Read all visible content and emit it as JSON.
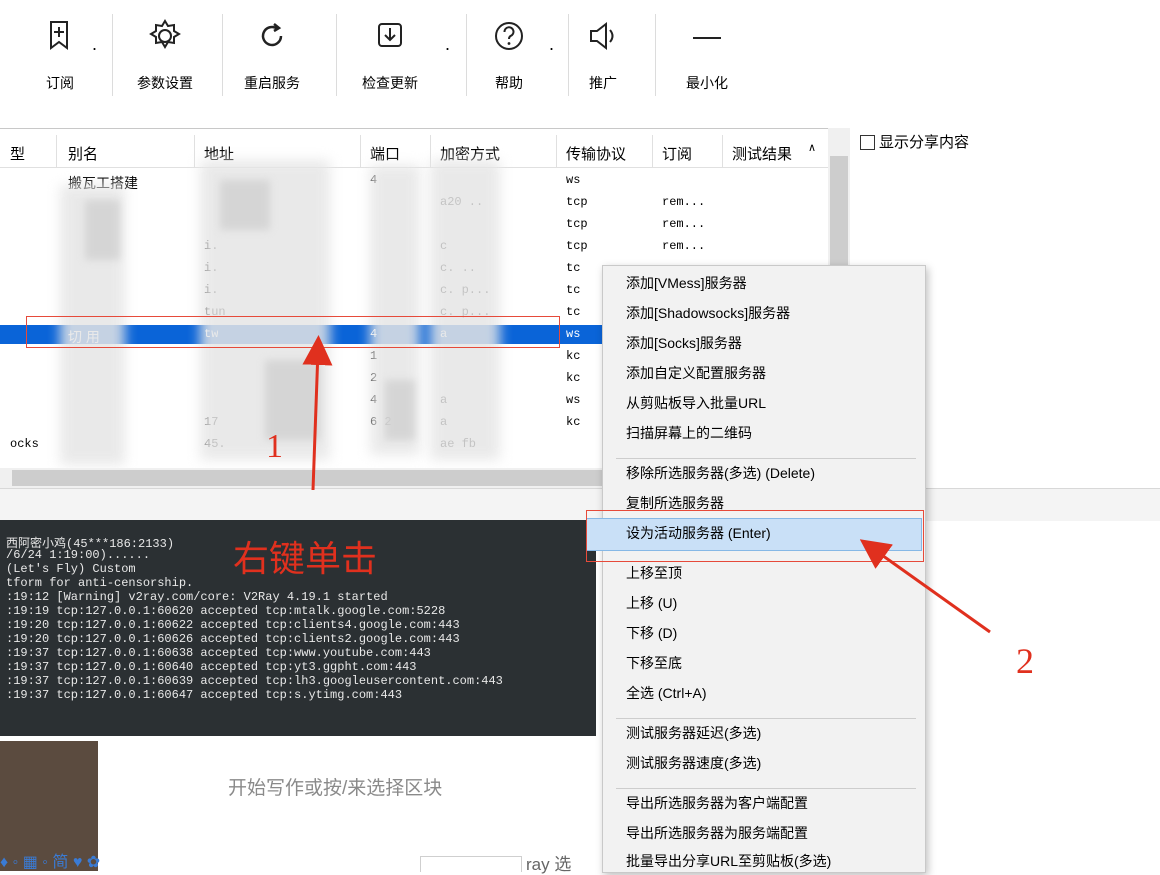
{
  "toolbar": {
    "buttons": [
      {
        "label": "订阅",
        "icon": "subscribe-icon",
        "has_dropdown": true
      },
      {
        "label": "参数设置",
        "icon": "gear-icon",
        "has_dropdown": false
      },
      {
        "label": "重启服务",
        "icon": "restart-icon",
        "has_dropdown": false
      },
      {
        "label": "检查更新",
        "icon": "download-icon",
        "has_dropdown": true
      },
      {
        "label": "帮助",
        "icon": "help-icon",
        "has_dropdown": true
      },
      {
        "label": "推广",
        "icon": "speaker-icon",
        "has_dropdown": false
      },
      {
        "label": "最小化",
        "icon": "minimize-icon",
        "has_dropdown": false
      }
    ]
  },
  "server_list": {
    "columns": [
      "型",
      "别名",
      "地址",
      "端口",
      "加密方式",
      "传输协议",
      "订阅",
      "测试结果"
    ],
    "rows": [
      {
        "alias": "搬瓦工搭建",
        "address": "",
        "port": "4",
        "security": "",
        "network": "ws",
        "subid": ""
      },
      {
        "alias": "",
        "address": "",
        "port": "",
        "security": "a20 ..",
        "network": "tcp",
        "subid": "rem..."
      },
      {
        "alias": "",
        "address": "",
        "port": "",
        "security": "",
        "network": "tcp",
        "subid": "rem..."
      },
      {
        "alias": "",
        "address": "i.",
        "port": "",
        "security": "c",
        "network": "tcp",
        "subid": "rem..."
      },
      {
        "alias": "",
        "address": "i.",
        "port": "",
        "security": "c. ..",
        "network": "tc",
        "subid": ""
      },
      {
        "alias": "",
        "address": "i.",
        "port": "",
        "security": "c. p...",
        "network": "tc",
        "subid": ""
      },
      {
        "alias": "",
        "address": "tun",
        "port": "",
        "security": "c. p...",
        "network": "tc",
        "subid": ""
      },
      {
        "alias": "切 用",
        "address": "tw",
        "port": "4",
        "security": "a",
        "network": "ws",
        "subid": "",
        "selected": true
      },
      {
        "alias": "",
        "address": "",
        "port": "1",
        "security": "",
        "network": "kc",
        "subid": ""
      },
      {
        "alias": "",
        "address": "",
        "port": "2",
        "security": "",
        "network": "kc",
        "subid": ""
      },
      {
        "alias": "",
        "address": "",
        "port": "4",
        "security": "a",
        "network": "ws",
        "subid": ""
      },
      {
        "alias": "",
        "address": "17",
        "port": "6 2",
        "security": "a",
        "network": "kc",
        "subid": ""
      },
      {
        "type": "ocks",
        "alias": "",
        "address": "45.",
        "port": "",
        "security": "ae fb",
        "network": "",
        "subid": ""
      }
    ]
  },
  "share_checkbox": {
    "label": "显示分享内容",
    "checked": false
  },
  "log": {
    "lines": [
      "西阿密小鸡(45***186:2133)",
      "/6/24 1:19:00)......",
      "(Let's Fly) Custom",
      "tform for anti-censorship.",
      ":19:12 [Warning] v2ray.com/core: V2Ray 4.19.1 started",
      ":19:19 tcp:127.0.0.1:60620 accepted tcp:mtalk.google.com:5228",
      ":19:20 tcp:127.0.0.1:60622 accepted tcp:clients4.google.com:443",
      ":19:20 tcp:127.0.0.1:60626 accepted tcp:clients2.google.com:443",
      ":19:37 tcp:127.0.0.1:60638 accepted tcp:www.youtube.com:443",
      ":19:37 tcp:127.0.0.1:60640 accepted tcp:yt3.ggpht.com:443",
      ":19:37 tcp:127.0.0.1:60639 accepted tcp:lh3.googleusercontent.com:443",
      ":19:37 tcp:127.0.0.1:60647 accepted tcp:s.ytimg.com:443"
    ]
  },
  "context_menu": {
    "groups": [
      [
        "添加[VMess]服务器",
        "添加[Shadowsocks]服务器",
        "添加[Socks]服务器",
        "添加自定义配置服务器",
        "从剪贴板导入批量URL",
        "扫描屏幕上的二维码"
      ],
      [
        "移除所选服务器(多选)  (Delete)",
        "复制所选服务器",
        "设为活动服务器  (Enter)",
        "上移至顶",
        "上移  (U)",
        "下移  (D)",
        "下移至底",
        "全选  (Ctrl+A)"
      ],
      [
        "测试服务器延迟(多选)",
        "测试服务器速度(多选)"
      ],
      [
        "导出所选服务器为客户端配置",
        "导出所选服务器为服务端配置",
        "批量导出分享URL至剪贴板(多选)"
      ]
    ],
    "active_item": "设为活动服务器  (Enter)"
  },
  "annotations": {
    "right_click": "右键单击",
    "step1": "1",
    "step2": "2",
    "color": "#e0301e"
  },
  "editor": {
    "hint": "开始写作或按/来选择区块",
    "partial_text": "ray 选"
  }
}
